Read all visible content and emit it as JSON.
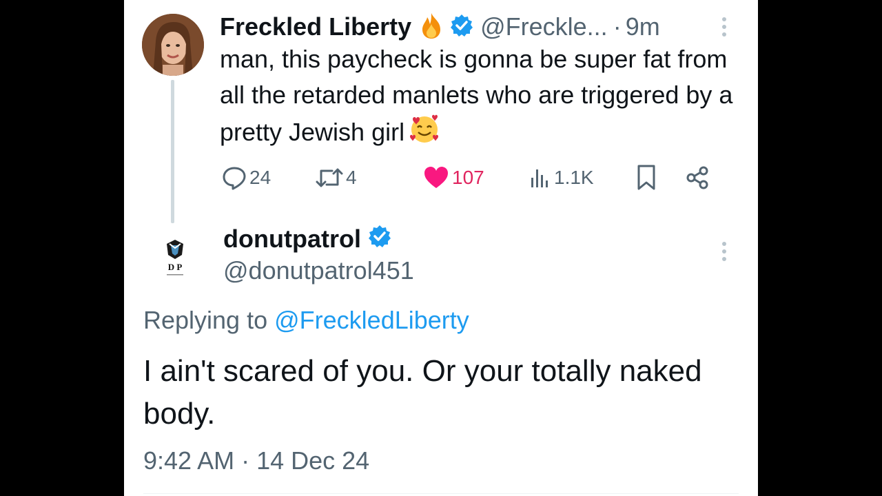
{
  "tweet1": {
    "author_name": "Freckled Liberty",
    "name_emoji": "fire-emoji",
    "handle": "@Freckle...",
    "separator": "·",
    "age": "9m",
    "text": "man, this paycheck is gonna be super fat from all the retarded manlets who are triggered by a pretty Jewish girl",
    "text_emoji": "smiling-face-with-hearts-emoji",
    "stats": {
      "replies": "24",
      "reposts": "4",
      "likes": "107",
      "views": "1.1K"
    },
    "icons": [
      "reply-icon",
      "repost-icon",
      "like-icon",
      "views-icon",
      "bookmark-icon",
      "share-icon",
      "more-icon"
    ]
  },
  "tweet2": {
    "author_name": "donutpatrol",
    "handle": "@donutpatrol451",
    "avatar_text": "D P",
    "replying_prefix": "Replying to",
    "replying_mention": "@FreckledLiberty",
    "text": "I ain't scared of you. Or your totally naked body.",
    "timestamp": "9:42 AM · 14 Dec 24"
  },
  "colors": {
    "background": "#ffffff",
    "outer": "#000000",
    "text": "#0f1419",
    "secondary": "#536471",
    "accent": "#1d9bf0",
    "like": "#e0245e",
    "thread_line": "#cfd9de"
  }
}
